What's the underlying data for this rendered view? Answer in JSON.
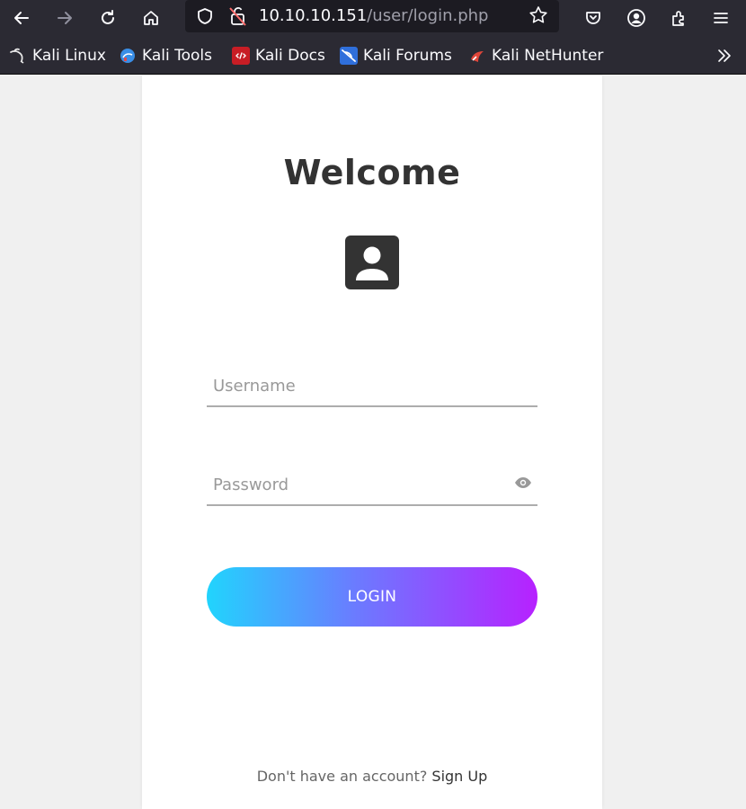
{
  "browser": {
    "url_host": "10.10.10.151",
    "url_path": "/user/login.php",
    "icons": {
      "back": "back-arrow-icon",
      "forward": "forward-arrow-icon",
      "reload": "reload-icon",
      "home": "home-icon",
      "shield": "tracking-shield-icon",
      "insecure": "insecure-lock-icon",
      "bookmark_star": "star-icon",
      "pocket": "pocket-icon",
      "account": "account-icon",
      "extensions": "extensions-icon",
      "menu": "hamburger-menu-icon",
      "overflow": "chevron-double-right-icon"
    }
  },
  "bookmarks": [
    {
      "label": "Kali Linux",
      "icon": "kali-dragon-icon"
    },
    {
      "label": "Kali Tools",
      "icon": "kali-tools-icon"
    },
    {
      "label": "Kali Docs",
      "icon": "kali-docs-icon"
    },
    {
      "label": "Kali Forums",
      "icon": "kali-forums-icon"
    },
    {
      "label": "Kali NetHunter",
      "icon": "kali-nethunter-icon"
    }
  ],
  "login": {
    "title": "Welcome",
    "username_placeholder": "Username",
    "password_placeholder": "Password",
    "button_label": "LOGIN",
    "signup_prompt": "Don't have an account? ",
    "signup_link": "Sign Up",
    "button_gradient": [
      "#21d4fd",
      "#b721ff"
    ]
  }
}
